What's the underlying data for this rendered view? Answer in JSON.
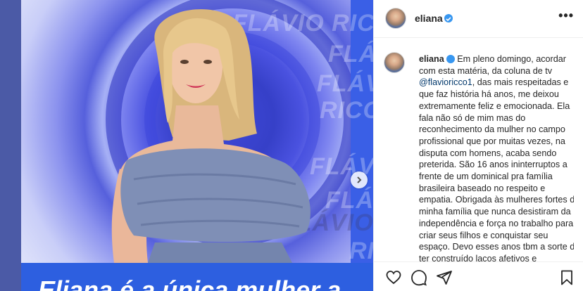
{
  "post": {
    "watermarks": [
      "FLÁVIO RIC",
      "FLÁ",
      "FLÁV",
      "RICC",
      "FLÁVIO",
      "FLÁVIO",
      "FLÁVIO",
      "RIC"
    ],
    "banner_text": "Eliana é a única mulher a"
  },
  "panel": {
    "username": "eliana",
    "caption_username": "eliana",
    "caption_pre": " Em pleno domingo, acordar com esta matéria, da coluna de tv ",
    "mention": "@flavioricco1",
    "caption_post": ", das mais respeitadas e que faz história há anos, me deixou extremamente feliz e emocionada. Ela fala não só de mim mas do reconhecimento da mulher no campo profissional que por muitas vezes, na disputa com homens, acaba sendo preterida. São 16 anos ininterruptos a frente de um dominical pra família brasileira baseado no respeito e empatia. Obrigada às mulheres fortes da minha família que nunca desistiram da independência e força no trabalho para criar seus filhos e conquistar seu espaço. Devo esses anos tbm a sorte de ter construído laços afetivos e respeitosos com equipes de grandes"
  },
  "icons": {
    "verified": "verified-badge-icon",
    "more": "more-options-icon",
    "like": "heart-icon",
    "comment": "comment-icon",
    "share": "share-icon",
    "save": "bookmark-icon",
    "next": "chevron-right-icon"
  },
  "colors": {
    "verified_blue": "#3897f0",
    "banner_blue": "#2d5fe0",
    "text": "#262626"
  }
}
